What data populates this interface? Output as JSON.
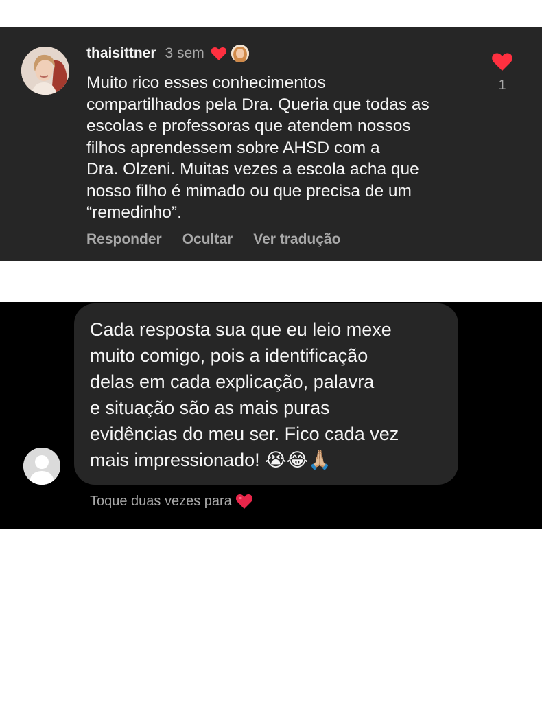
{
  "comment": {
    "username": "thaisittner",
    "time": "3 sem",
    "text": "Muito rico esses conhecimentos\ncompartilhados pela Dra. Queria que todas as\nescolas e professoras que atendem nossos\nfilhos aprendessem sobre AHSD com a\nDra. Olzeni. Muitas vezes a escola acha que\nnosso filho é mimado ou que precisa de um\n“remedinho”.",
    "actions": {
      "reply": "Responder",
      "hide": "Ocultar",
      "translate": "Ver tradução"
    },
    "like_count": "1",
    "icons": {
      "avatar": "user-avatar-photo",
      "liked_by_author": "red-heart-icon",
      "author_avatar": "author-avatar-photo",
      "like": "red-heart-icon"
    }
  },
  "message": {
    "text": "Cada resposta sua que eu leio mexe\nmuito comigo, pois a identificação\ndelas em cada explicação, palavra\ne situação são as mais puras\nevidências do meu ser.  Fico cada vez\nmais impressionado! 😭😂🙏🏼",
    "hint": "Toque duas vezes para",
    "icons": {
      "avatar": "default-user-avatar-icon",
      "hint_heart": "heart-emoji-icon"
    }
  },
  "colors": {
    "comment_bg": "#262626",
    "dm_bg": "#000000",
    "bubble_bg": "#262626",
    "primary_text": "#f5f5f5",
    "secondary_text": "#a8a8a8",
    "heart_red": "#ff3040"
  }
}
